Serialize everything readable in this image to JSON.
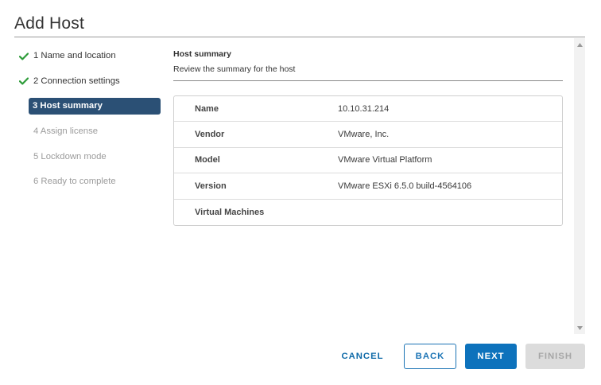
{
  "dialog": {
    "title": "Add Host"
  },
  "steps": [
    {
      "label": "1 Name and location",
      "state": "done"
    },
    {
      "label": "2 Connection settings",
      "state": "done"
    },
    {
      "label": "3 Host summary",
      "state": "active"
    },
    {
      "label": "4 Assign license",
      "state": "pending"
    },
    {
      "label": "5 Lockdown mode",
      "state": "pending"
    },
    {
      "label": "6 Ready to complete",
      "state": "pending"
    }
  ],
  "content": {
    "title": "Host summary",
    "subtitle": "Review the summary for the host"
  },
  "summary": [
    {
      "key": "Name",
      "value": "10.10.31.214"
    },
    {
      "key": "Vendor",
      "value": "VMware, Inc."
    },
    {
      "key": "Model",
      "value": "VMware Virtual Platform"
    },
    {
      "key": "Version",
      "value": "VMware ESXi 6.5.0 build-4564106"
    },
    {
      "key": "Virtual Machines",
      "value": ""
    }
  ],
  "buttons": {
    "cancel": "CANCEL",
    "back": "BACK",
    "next": "NEXT",
    "finish": "FINISH"
  },
  "colors": {
    "active_step": "#2b5075",
    "check": "#2e9c3a",
    "primary": "#0d72bc"
  },
  "icons": {
    "done": "check-icon",
    "scroll_up": "scroll-up-arrow-icon",
    "scroll_down": "scroll-down-arrow-icon"
  }
}
